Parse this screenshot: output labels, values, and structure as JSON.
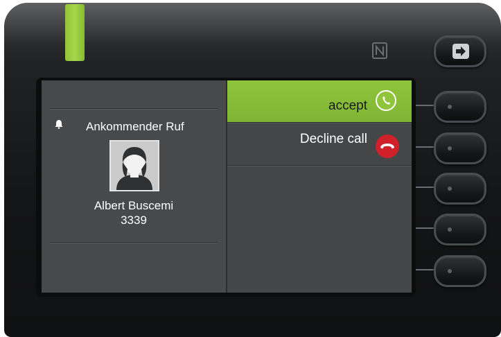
{
  "led": {
    "color": "#9ccd41"
  },
  "header": {
    "nfc_icon": "nfc-icon"
  },
  "incoming_call": {
    "title": "Ankommender Ruf",
    "caller_name": "Albert Buscemi",
    "caller_number": "3339",
    "icons": {
      "alert": "bell-icon",
      "avatar": "person-avatar-icon"
    }
  },
  "menu": {
    "items": [
      {
        "label": "accept",
        "icon": "phone-accept-icon",
        "selected": true,
        "icon_color": "#8fc43c"
      },
      {
        "label": "Decline call",
        "icon": "phone-hangup-icon",
        "selected": false,
        "icon_color": "#d0202a"
      }
    ]
  },
  "hardware_buttons": {
    "top": {
      "icon": "exit-icon"
    },
    "softkeys": [
      "softkey-1",
      "softkey-2",
      "softkey-3",
      "softkey-4",
      "softkey-5"
    ]
  }
}
